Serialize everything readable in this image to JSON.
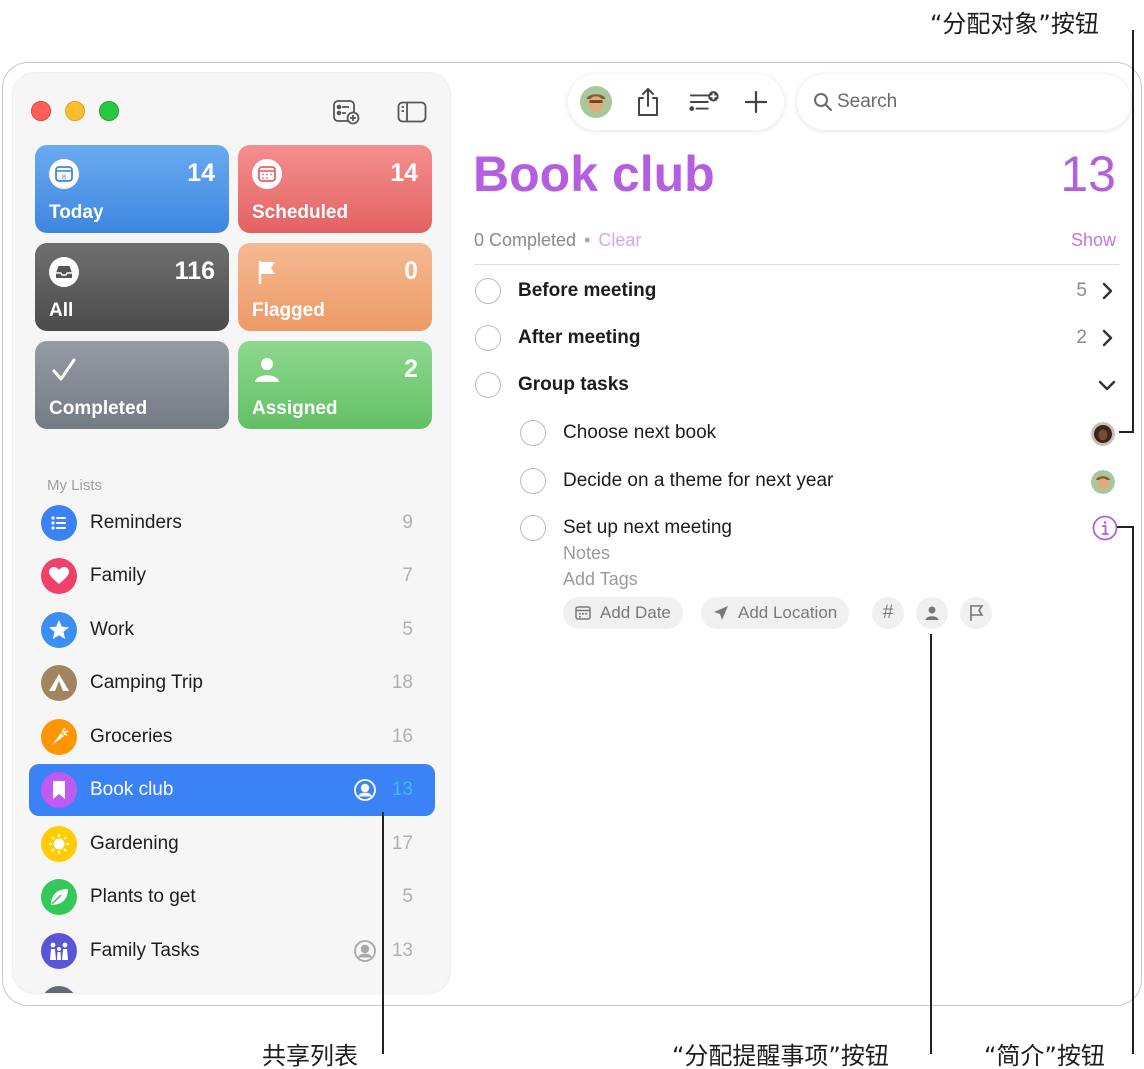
{
  "sidebar": {
    "tiles": {
      "today": {
        "label": "Today",
        "count": "14",
        "icon_day": "8"
      },
      "scheduled": {
        "label": "Scheduled",
        "count": "14"
      },
      "all": {
        "label": "All",
        "count": "116"
      },
      "flagged": {
        "label": "Flagged",
        "count": "0"
      },
      "completed": {
        "label": "Completed"
      },
      "assigned": {
        "label": "Assigned",
        "count": "2"
      }
    },
    "section_label": "My Lists",
    "lists": [
      {
        "label": "Reminders",
        "count": "9",
        "color": "#3b82f6",
        "icon": "list-icon"
      },
      {
        "label": "Family",
        "count": "7",
        "color": "#f0416b",
        "icon": "heart-icon"
      },
      {
        "label": "Work",
        "count": "5",
        "color": "#3b8ff0",
        "icon": "star-icon"
      },
      {
        "label": "Camping Trip",
        "count": "18",
        "color": "#a2845e",
        "icon": "tent-icon"
      },
      {
        "label": "Groceries",
        "count": "16",
        "color": "#ff9500",
        "icon": "carrot-icon"
      },
      {
        "label": "Book club",
        "count": "13",
        "color": "#bf5af2",
        "icon": "bookmark-icon",
        "selected": true,
        "shared": true
      },
      {
        "label": "Gardening",
        "count": "17",
        "color": "#ffcc00",
        "icon": "sun-icon"
      },
      {
        "label": "Plants to get",
        "count": "5",
        "color": "#34c759",
        "icon": "leaf-icon"
      },
      {
        "label": "Family Tasks",
        "count": "13",
        "color": "#5856d6",
        "icon": "family-icon",
        "shared": true
      }
    ]
  },
  "toolbar": {
    "search_placeholder": "Search"
  },
  "main": {
    "title": "Book club",
    "count": "13",
    "completed_text": "0 Completed",
    "clear_label": "Clear",
    "show_label": "Show",
    "groups": [
      {
        "title": "Before meeting",
        "count": "5"
      },
      {
        "title": "After meeting",
        "count": "2"
      },
      {
        "title": "Group tasks"
      }
    ],
    "subtasks": [
      {
        "title": "Choose next book"
      },
      {
        "title": "Decide on a theme for next year"
      },
      {
        "title": "Set up next meeting",
        "notes_placeholder": "Notes",
        "tags_placeholder": "Add Tags"
      }
    ],
    "add_date_label": "Add Date",
    "add_location_label": "Add Location",
    "tag_symbol": "#"
  },
  "callouts": {
    "assign_to": "“分配对象”按钮",
    "shared_list": "共享列表",
    "assign_reminder": "“分配提醒事项”按钮",
    "info": "“简介”按钮"
  },
  "colors": {
    "accent": "#b45fe0",
    "selection": "#3b82f6"
  }
}
